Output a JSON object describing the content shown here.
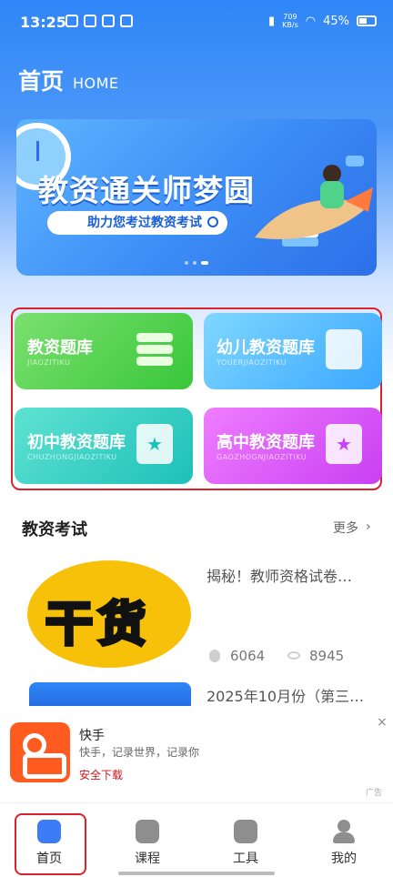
{
  "status_bar": {
    "time": "13:25",
    "net_speed_top": "709",
    "net_speed_unit": "KB/s",
    "battery": "45%"
  },
  "header": {
    "title": "首页",
    "subtitle": "HOME"
  },
  "banner": {
    "headline": "教资通关师梦圆",
    "tagline": "助力您考过教资考试",
    "slides": 3,
    "active_slide": 3
  },
  "categories": [
    {
      "title": "教资题库",
      "subtitle": "JIAOZITIKU",
      "color": "#39c73b",
      "icon": "books-icon"
    },
    {
      "title": "幼儿教资题库",
      "subtitle": "YOUERJIAOZITIKU",
      "color": "#3ba7ff",
      "icon": "bookmark-icon"
    },
    {
      "title": "初中教资题库",
      "subtitle": "CHUZHONGJIAOZITIKU",
      "color": "#1dc0b8",
      "icon": "star-bookmark-icon"
    },
    {
      "title": "高中教资题库",
      "subtitle": "GAOZHOGNJIAOZITIKU",
      "color": "#c93ff2",
      "icon": "star-bookmark-icon"
    }
  ],
  "section": {
    "title": "教资考试",
    "more": "更多",
    "chevron": "›"
  },
  "articles": [
    {
      "title": "揭秘！教师资格试卷…",
      "thumb_text": "干货",
      "views": "6064",
      "reads": "8945"
    },
    {
      "title": "2025年10月份（第三…"
    }
  ],
  "ad": {
    "name": "快手",
    "desc": "快手，记录世界，记录你",
    "download": "安全下载",
    "close": "×",
    "tag": "广告"
  },
  "tabbar": {
    "items": [
      {
        "label": "首页",
        "icon": "home-icon",
        "active": true
      },
      {
        "label": "课程",
        "icon": "course-icon",
        "active": false
      },
      {
        "label": "工具",
        "icon": "tools-icon",
        "active": false
      },
      {
        "label": "我的",
        "icon": "user-icon",
        "active": false
      }
    ]
  },
  "colors": {
    "primary": "#2f86f7",
    "highlight_border": "#d9232c"
  }
}
